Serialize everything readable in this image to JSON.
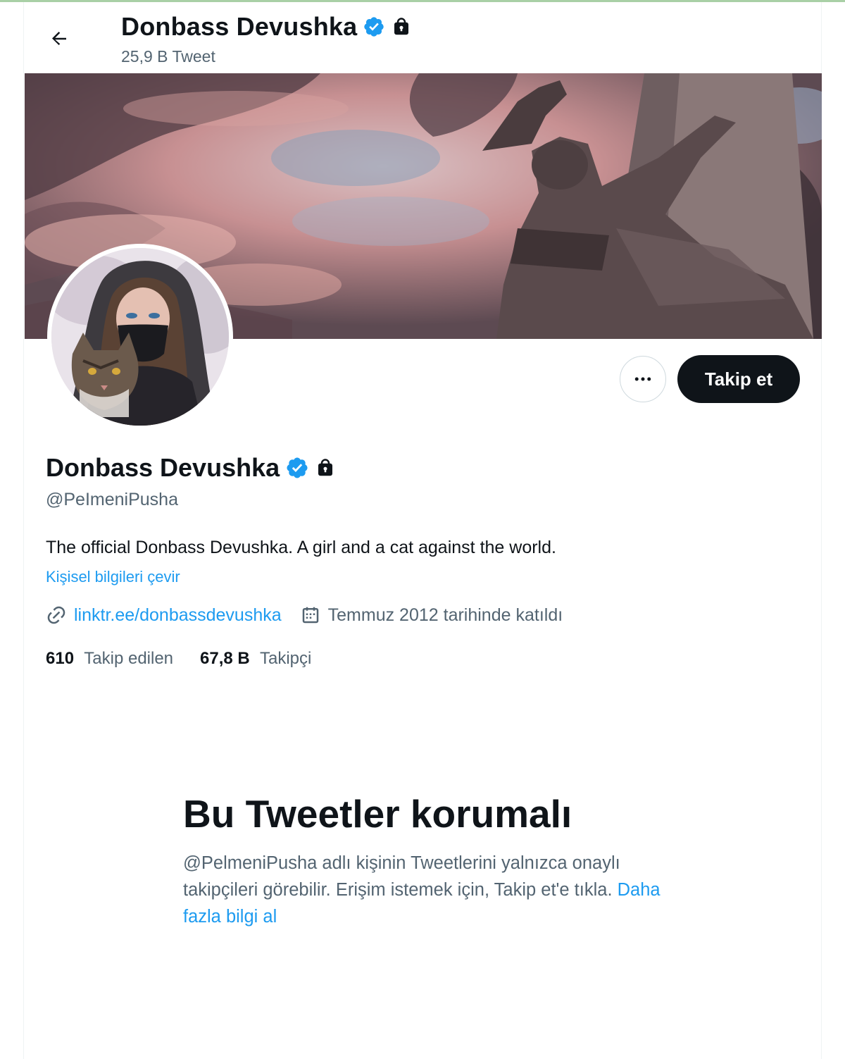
{
  "header": {
    "name": "Donbass Devushka",
    "tweet_count": "25,9 B Tweet"
  },
  "profile": {
    "name": "Donbass Devushka",
    "handle": "@PeImeniPusha",
    "bio": "The official Donbass Devushka. A girl and a cat against the world.",
    "translate_label": "Kişisel bilgileri çevir",
    "link_text": "linktr.ee/donbassdevushka",
    "joined_text": "Temmuz 2012 tarihinde katıldı",
    "following_count": "610",
    "following_label": "Takip edilen",
    "followers_count": "67,8 B",
    "followers_label": "Takipçi",
    "verified": true,
    "protected": true
  },
  "actions": {
    "follow_label": "Takip et",
    "more_icon": "more-horizontal-icon"
  },
  "protected_notice": {
    "title": "Bu Tweetler korumalı",
    "body": "@PelmeniPusha adlı kişinin Tweetlerini yalnızca onaylı takipçileri görebilir. Erişim istemek için, Takip et'e tıkla.",
    "learn_more": "Daha fazla bilgi al"
  },
  "colors": {
    "accent": "#1d9bf0",
    "text": "#0f1419",
    "secondary": "#536471",
    "follow_button": "#0f1419"
  }
}
